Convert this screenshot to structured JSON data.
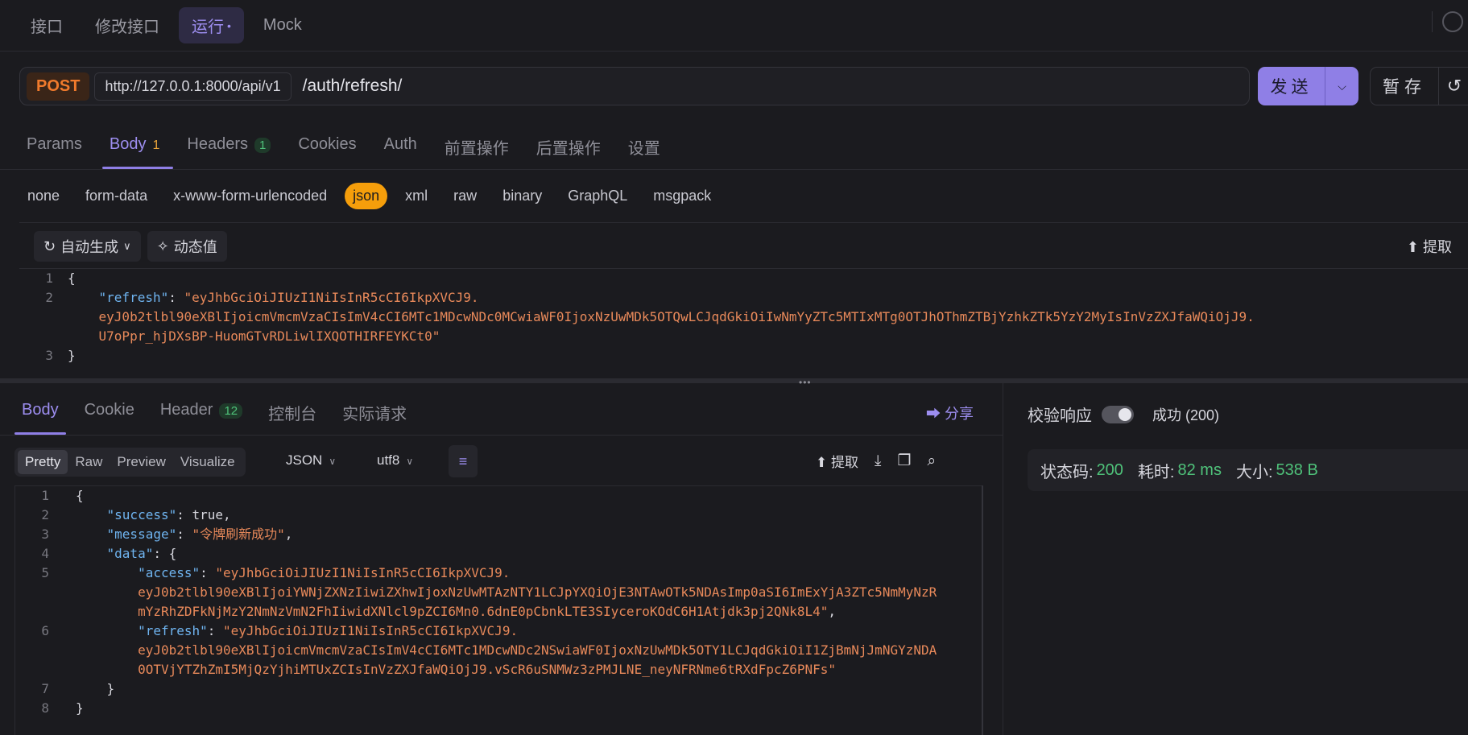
{
  "top_tabs": [
    "接口",
    "修改接口",
    "运行",
    "Mock"
  ],
  "top_tab_active_dot": "•",
  "request": {
    "method": "POST",
    "base_url": "http://127.0.0.1:8000/api/v1",
    "path": "/auth/refresh/",
    "send_label": "发送",
    "save_label": "暂存"
  },
  "request_tabs": {
    "params": "Params",
    "body": "Body",
    "body_count": "1",
    "headers": "Headers",
    "headers_count": "1",
    "cookies": "Cookies",
    "auth": "Auth",
    "pre": "前置操作",
    "post": "后置操作",
    "settings": "设置"
  },
  "body_types": [
    "none",
    "form-data",
    "x-www-form-urlencoded",
    "json",
    "xml",
    "raw",
    "binary",
    "GraphQL",
    "msgpack"
  ],
  "body_type_active": "json",
  "request_editor": {
    "auto_generate": "自动生成",
    "dynamic_value": "动态值",
    "extract": "提取",
    "line_numbers": [
      "1",
      "2",
      "3"
    ],
    "open_brace": "{",
    "close_brace": "}",
    "refresh_key": "\"refresh\"",
    "refresh_value_1": "\"eyJhbGciOiJIUzI1NiIsInR5cCI6IkpXVCJ9.",
    "refresh_value_2": "eyJ0b2tlbl90eXBlIjoicmVmcmVzaCIsImV4cCI6MTc1MDcwNDc0MCwiaWF0IjoxNzUwMDk5OTQwLCJqdGkiOiIwNmYyZTc5MTIxMTg0OTJhOThmZTBjYzhkZTk5YzY2MyIsInVzZXJfaWQiOjJ9.",
    "refresh_value_3": "U7oPpr_hjDXsBP-HuomGTvRDLiwlIXQOTHIRFEYKCt0\""
  },
  "response_tabs": {
    "body": "Body",
    "cookie": "Cookie",
    "header": "Header",
    "header_count": "12",
    "console": "控制台",
    "actual_request": "实际请求",
    "share": "分享"
  },
  "response_toolbar": {
    "views": [
      "Pretty",
      "Raw",
      "Preview",
      "Visualize"
    ],
    "view_active": "Pretty",
    "format": "JSON",
    "encoding": "utf8",
    "extract": "提取"
  },
  "response_body": {
    "line_numbers": [
      "1",
      "2",
      "3",
      "4",
      "5",
      "6",
      "7",
      "8"
    ],
    "success_key": "\"success\"",
    "success_value": "true",
    "message_key": "\"message\"",
    "message_value": "\"令牌刷新成功\"",
    "data_key": "\"data\"",
    "access_key": "\"access\"",
    "access_value_1": "\"eyJhbGciOiJIUzI1NiIsInR5cCI6IkpXVCJ9.",
    "access_value_2": "eyJ0b2tlbl90eXBlIjoiYWNjZXNzIiwiZXhwIjoxNzUwMTAzNTY1LCJpYXQiOjE3NTAwOTk5NDAsImp0aSI6ImExYjA3ZTc5NmMyNzR",
    "access_value_3": "mYzRhZDFkNjMzY2NmNzVmN2FhIiwidXNlcl9pZCI6Mn0.6dnE0pCbnkLTE3SIyceroKOdC6H1Atjdk3pj2QNk8L4\"",
    "refresh_key": "\"refresh\"",
    "refresh_value_1": "\"eyJhbGciOiJIUzI1NiIsInR5cCI6IkpXVCJ9.",
    "refresh_value_2": "eyJ0b2tlbl90eXBlIjoicmVmcmVzaCIsImV4cCI6MTc1MDcwNDc2NSwiaWF0IjoxNzUwMDk5OTY1LCJqdGkiOiI1ZjBmNjJmNGYzNDA",
    "refresh_value_3": "0OTVjYTZhZmI5MjQzYjhiMTUxZCIsInVzZXJfaWQiOjJ9.vScR6uSNMWz3zPMJLNE_neyNFRNme6tRXdFpcZ6PNFs\""
  },
  "verify": {
    "label": "校验响应",
    "result": "成功 (200)"
  },
  "status": {
    "code_label": "状态码:",
    "code": "200",
    "time_label": "耗时:",
    "time": "82 ms",
    "size_label": "大小:",
    "size": "538 B"
  }
}
